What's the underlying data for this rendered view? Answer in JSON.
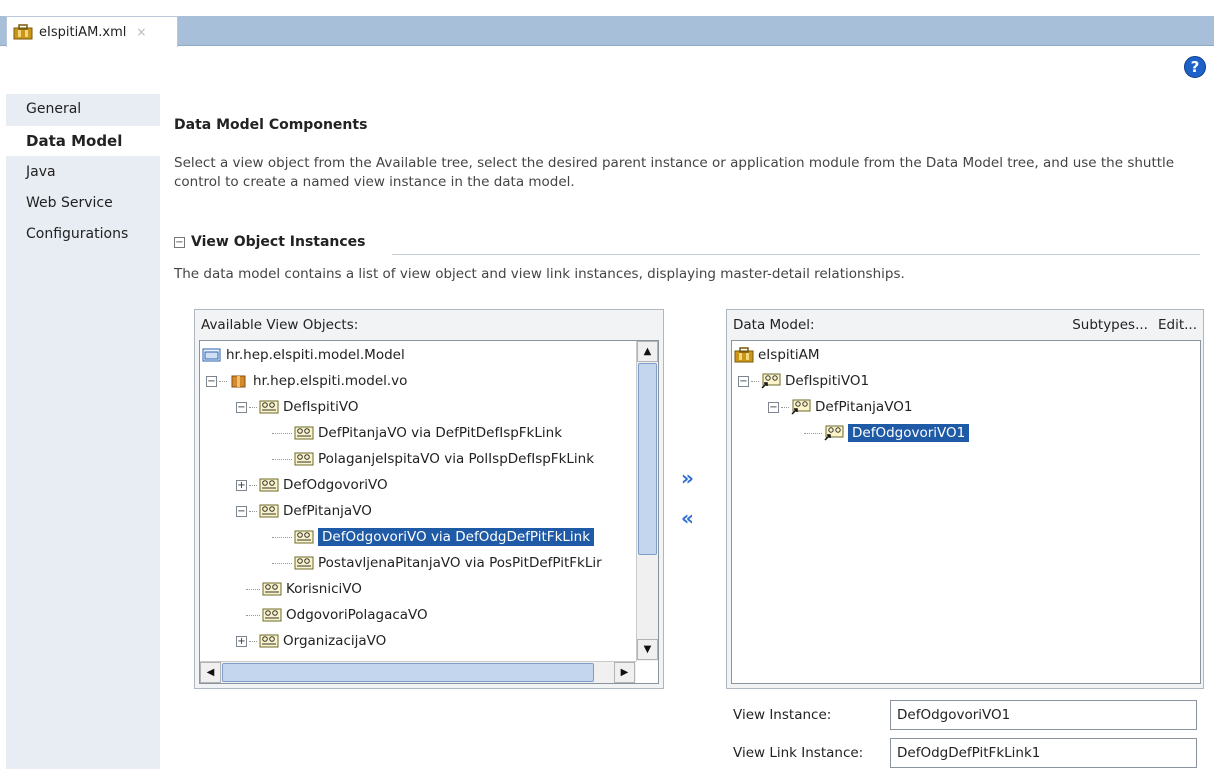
{
  "tab": {
    "title": "eIspitiAM.xml",
    "close": "×"
  },
  "help_icon": "?",
  "sidebar": {
    "items": [
      {
        "label": "General",
        "active": false
      },
      {
        "label": "Data Model",
        "active": true
      },
      {
        "label": "Java",
        "active": false
      },
      {
        "label": "Web Service",
        "active": false
      },
      {
        "label": "Configurations",
        "active": false
      }
    ]
  },
  "main": {
    "title": "Data Model Components",
    "description": "Select a view object from the Available tree, select the desired parent instance or application module from the Data Model tree, and use the shuttle control to create a named view instance in the data model.",
    "section": {
      "title": "View Object Instances",
      "collapse_symbol": "−",
      "description": "The data model contains a list of view object and view link instances, displaying master-detail relationships."
    }
  },
  "available": {
    "header": "Available View Objects:",
    "items": [
      {
        "label": "hr.hep.eIspiti.model.Model",
        "icon": "folder-icon"
      },
      {
        "label": "hr.hep.eIspiti.model.vo",
        "icon": "package-icon",
        "expander": "−"
      },
      {
        "label": "DefIspitiVO",
        "icon": "view-object-icon",
        "expander": "−"
      },
      {
        "label": "DefPitanjaVO via DefPitDefIspFkLink",
        "icon": "view-object-icon"
      },
      {
        "label": "PolaganjeIspitaVO via PolIspDefIspFkLink",
        "icon": "view-object-icon"
      },
      {
        "label": "DefOdgovoriVO",
        "icon": "view-object-icon",
        "expander": "+"
      },
      {
        "label": "DefPitanjaVO",
        "icon": "view-object-icon",
        "expander": "−"
      },
      {
        "label": "DefOdgovoriVO via DefOdgDefPitFkLink",
        "icon": "view-object-icon",
        "selected": true
      },
      {
        "label": "PostavljenaPitanjaVO via PosPitDefPitFkLir",
        "icon": "view-object-icon"
      },
      {
        "label": "KorisniciVO",
        "icon": "view-object-icon"
      },
      {
        "label": "OdgovoriPolagacaVO",
        "icon": "view-object-icon"
      },
      {
        "label": "OrganizacijaVO",
        "icon": "view-object-icon",
        "expander": "+"
      }
    ]
  },
  "shuttle": {
    "add": "»",
    "remove": "«"
  },
  "data_model": {
    "header": "Data Model:",
    "subtypes_label": "Subtypes...",
    "edit_label": "Edit...",
    "items": [
      {
        "label": "eIspitiAM",
        "icon": "application-module-icon"
      },
      {
        "label": "DefIspitiVO1",
        "icon": "view-instance-icon",
        "expander": "−"
      },
      {
        "label": "DefPitanjaVO1",
        "icon": "view-instance-icon",
        "expander": "−"
      },
      {
        "label": "DefOdgovoriVO1",
        "icon": "view-instance-icon",
        "selected": true
      }
    ]
  },
  "fields": {
    "view_instance_label": "View Instance:",
    "view_instance_value": "DefOdgovoriVO1",
    "view_link_instance_label": "View Link Instance:",
    "view_link_instance_value": "DefOdgDefPitFkLink1"
  },
  "colors": {
    "selection": "#1f5aa6",
    "tabstrip": "#a7bfd9",
    "sidebar": "#e8edf3",
    "help": "#1e62c8"
  }
}
